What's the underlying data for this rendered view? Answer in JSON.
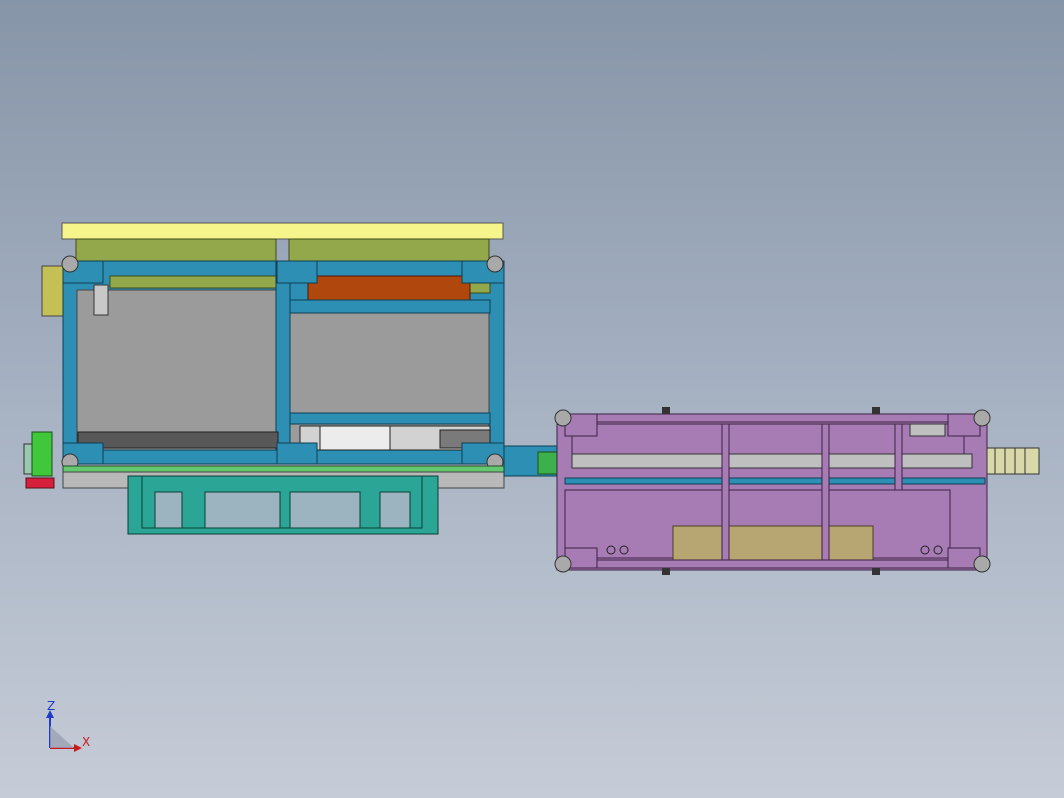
{
  "viewport": {
    "background_top": "#8795a8",
    "background_bottom": "#c6ccd7"
  },
  "colors": {
    "top_rail": "#f5f58c",
    "olive_panel": "#93a84a",
    "frame_blue": "#2c8fb3",
    "frame_outline": "#0f3f55",
    "gray_panel": "#9b9b9b",
    "orange_block": "#b0480e",
    "teal_stand": "#2aa596",
    "lilac_cabinet": "#a77bb4",
    "khaki_panel": "#b7a572",
    "green_motor": "#41c83a",
    "red_base": "#d61f3a",
    "node_gray": "#a9a9a9"
  },
  "triad": {
    "z_label": "Z",
    "x_label": "X",
    "z_color": "#1f3cc8",
    "x_color": "#c81a1a"
  }
}
